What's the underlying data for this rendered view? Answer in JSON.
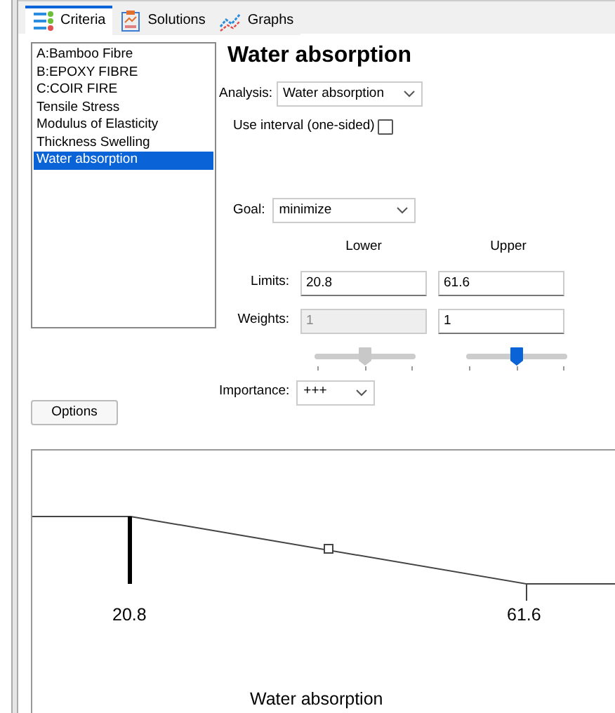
{
  "tabs": [
    {
      "label": "Criteria",
      "kind": "criteria",
      "selected": true
    },
    {
      "label": "Solutions",
      "kind": "solutions",
      "selected": false
    },
    {
      "label": "Graphs",
      "kind": "graphs",
      "selected": false
    }
  ],
  "criteria_list": [
    {
      "label": "A:Bamboo Fibre",
      "selected": false
    },
    {
      "label": "B:EPOXY FIBRE",
      "selected": false
    },
    {
      "label": "C:COIR FIRE",
      "selected": false
    },
    {
      "label": "Tensile Stress",
      "selected": false
    },
    {
      "label": "Modulus of Elasticity",
      "selected": false
    },
    {
      "label": "Thickness Swelling",
      "selected": false
    },
    {
      "label": "Water absorption",
      "selected": true
    }
  ],
  "options_button": "Options",
  "title": "Water absorption",
  "analysis": {
    "label": "Analysis:",
    "value": "Water absorption"
  },
  "use_interval": {
    "label": "Use interval (one-sided)",
    "checked": false
  },
  "goal": {
    "label": "Goal:",
    "value": "minimize"
  },
  "columns": [
    "Lower",
    "Upper"
  ],
  "limits": {
    "label": "Limits:",
    "lower": {
      "value": "20.8",
      "disabled": false
    },
    "upper": {
      "value": "61.6",
      "disabled": false
    }
  },
  "weights": {
    "label": "Weights:",
    "lower": {
      "value": "1",
      "disabled": true
    },
    "upper": {
      "value": "1",
      "disabled": false
    }
  },
  "sliders": [
    {
      "level": 0.5,
      "disabled": true
    },
    {
      "level": 0.5,
      "disabled": false
    }
  ],
  "importance": {
    "label": "Importance:",
    "value": "+++"
  },
  "plot": {
    "lower_label": "20.8",
    "upper_label": "61.6",
    "xlabel": "Water absorption"
  }
}
